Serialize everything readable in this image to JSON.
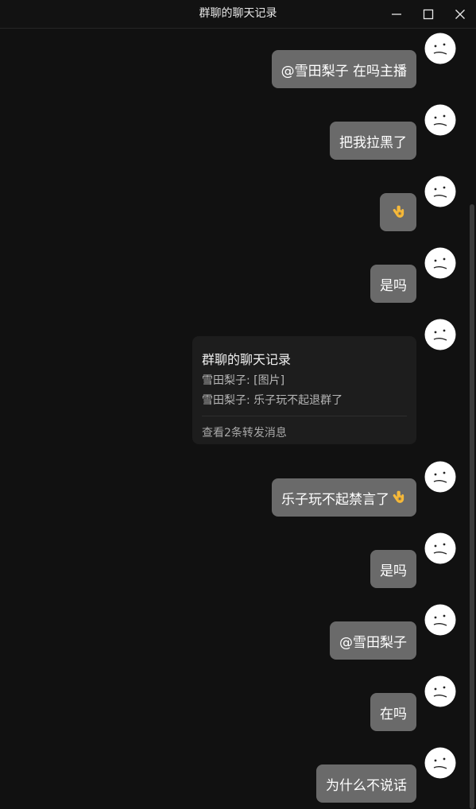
{
  "window": {
    "title": "群聊的聊天记录",
    "controls": [
      "minimize-icon",
      "maximize-icon",
      "close-icon"
    ]
  },
  "messages": [
    {
      "type": "text",
      "text": "@雪田梨子 在吗主播"
    },
    {
      "type": "text",
      "text": "把我拉黑了"
    },
    {
      "type": "emoji",
      "emoji": "ok-hand-icon"
    },
    {
      "type": "text",
      "text": "是吗"
    },
    {
      "type": "forward",
      "title": "群聊的聊天记录",
      "lines": [
        "雪田梨子: [图片]",
        "雪田梨子: 乐子玩不起退群了"
      ],
      "footer": "查看2条转发消息"
    },
    {
      "type": "text",
      "text": "乐子玩不起禁言了",
      "emoji": "ok-hand-icon"
    },
    {
      "type": "text",
      "text": "是吗"
    },
    {
      "type": "text",
      "text": "@雪田梨子"
    },
    {
      "type": "text",
      "text": "在吗"
    },
    {
      "type": "text",
      "text": "为什么不说话"
    }
  ],
  "colors": {
    "background": "#111111",
    "bubble": "#6a6a6a",
    "card": "#1d1d1d"
  }
}
